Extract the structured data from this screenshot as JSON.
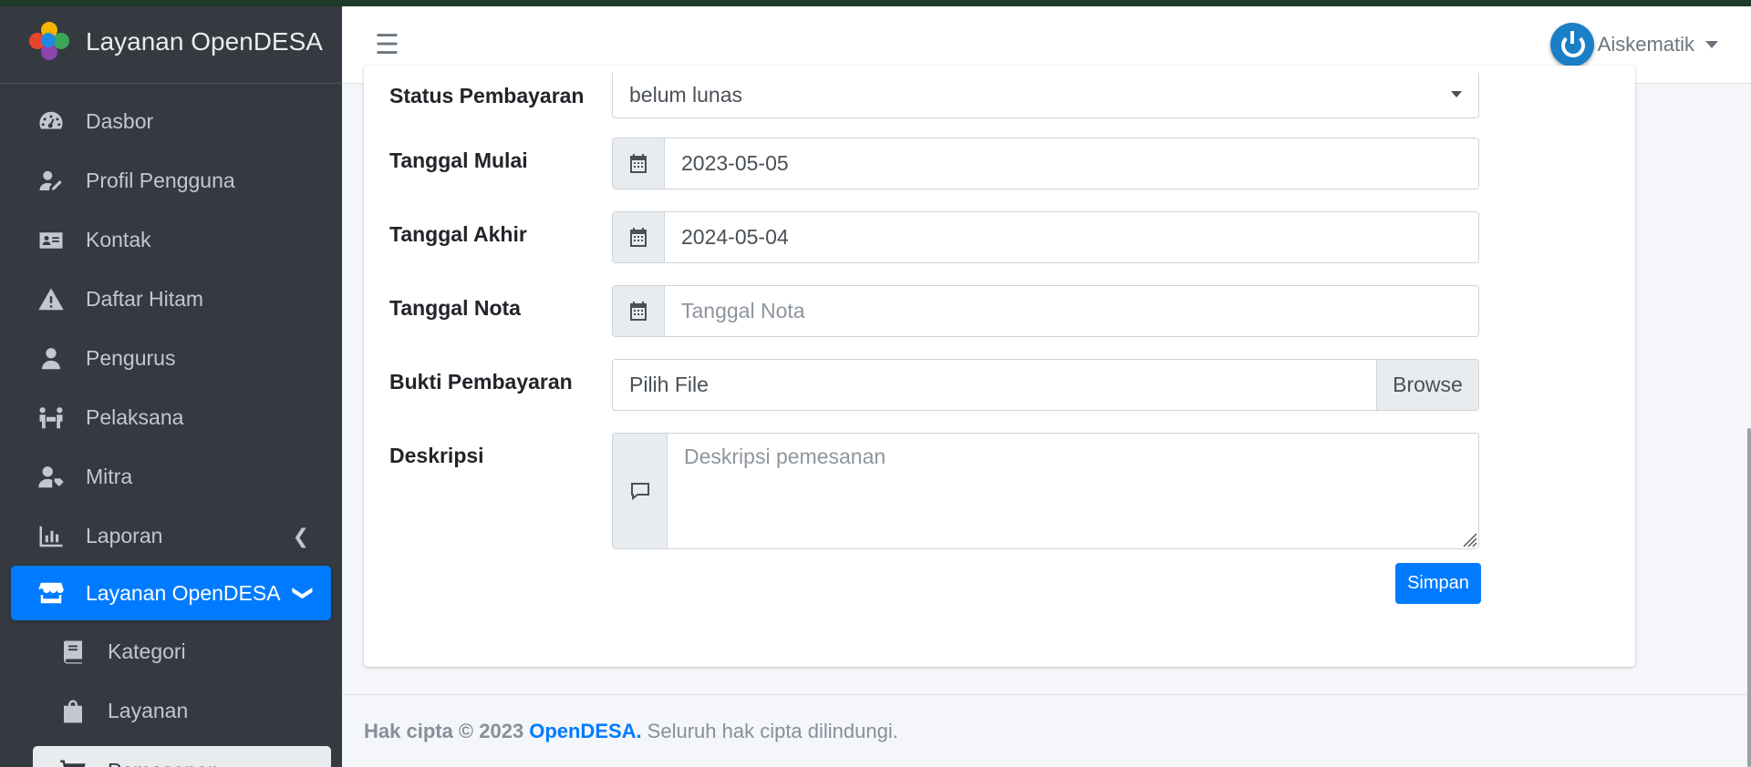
{
  "brand": {
    "name": "Layanan OpenDESA"
  },
  "sidebar": {
    "items": [
      {
        "label": "Dasbor",
        "icon": "tachometer-icon"
      },
      {
        "label": "Profil Pengguna",
        "icon": "user-edit-icon"
      },
      {
        "label": "Kontak",
        "icon": "address-card-icon"
      },
      {
        "label": "Daftar Hitam",
        "icon": "warning-icon"
      },
      {
        "label": "Pengurus",
        "icon": "user-tie-icon"
      },
      {
        "label": "Pelaksana",
        "icon": "people-carry-icon"
      },
      {
        "label": "Mitra",
        "icon": "user-tag-icon"
      },
      {
        "label": "Laporan",
        "icon": "chart-bar-icon"
      },
      {
        "label": "Layanan OpenDESA",
        "icon": "store-icon"
      },
      {
        "label": "Kategori",
        "icon": "book-icon"
      },
      {
        "label": "Layanan",
        "icon": "shopping-bag-icon"
      },
      {
        "label": "Pemesanan",
        "icon": "cart-icon"
      }
    ]
  },
  "navbar": {
    "user_name": "Aiskematik"
  },
  "form": {
    "status": {
      "label": "Status Pembayaran",
      "value": "belum lunas"
    },
    "start_date": {
      "label": "Tanggal Mulai",
      "value": "2023-05-05"
    },
    "end_date": {
      "label": "Tanggal Akhir",
      "value": "2024-05-04"
    },
    "note_date": {
      "label": "Tanggal Nota",
      "placeholder": "Tanggal Nota"
    },
    "proof": {
      "label": "Bukti Pembayaran",
      "value": "Pilih File",
      "browse": "Browse"
    },
    "description": {
      "label": "Deskripsi",
      "placeholder": "Deskripsi pemesanan"
    },
    "save": "Simpan"
  },
  "footer": {
    "prefix": "Hak cipta © 2023",
    "link": "OpenDESA.",
    "suffix": "Seluruh hak cipta dilindungi."
  },
  "colors": {
    "primary": "#007bff",
    "sidebar": "#343a40"
  }
}
